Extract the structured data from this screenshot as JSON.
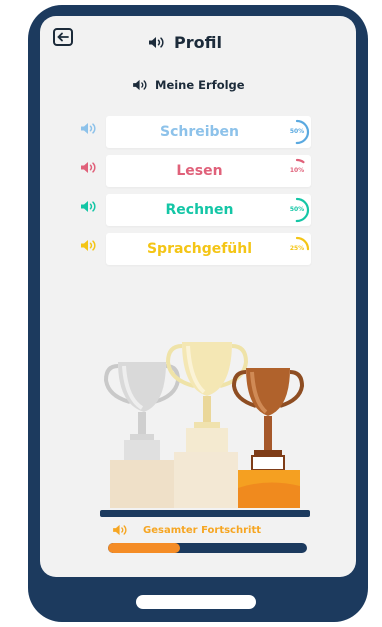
{
  "header": {
    "title": "Profil",
    "back_icon": "arrow-left-icon",
    "speaker_icon": "speaker-icon"
  },
  "achievements": {
    "title": "Meine Erfolge"
  },
  "skills": [
    {
      "label": "Schreiben",
      "percent_label": "50%",
      "progress": 0.5,
      "color": "#8dc2ea",
      "ring_color": "#5aa9e0"
    },
    {
      "label": "Lesen",
      "percent_label": "10%",
      "progress": 0.1,
      "color": "#e0617a",
      "ring_color": "#e0617a"
    },
    {
      "label": "Rechnen",
      "percent_label": "50%",
      "progress": 0.5,
      "color": "#14c6a6",
      "ring_color": "#14c6a6"
    },
    {
      "label": "Sprachgefühl",
      "percent_label": "25%",
      "progress": 0.25,
      "color": "#f4c516",
      "ring_color": "#f4c516"
    }
  ],
  "overall": {
    "label": "Gesamter Fortschritt",
    "progress": 0.36,
    "color": "#f48c26"
  },
  "colors": {
    "frame": "#1c3a5e",
    "screen": "#f2f2f2",
    "text_dark": "#1c2b3a"
  }
}
